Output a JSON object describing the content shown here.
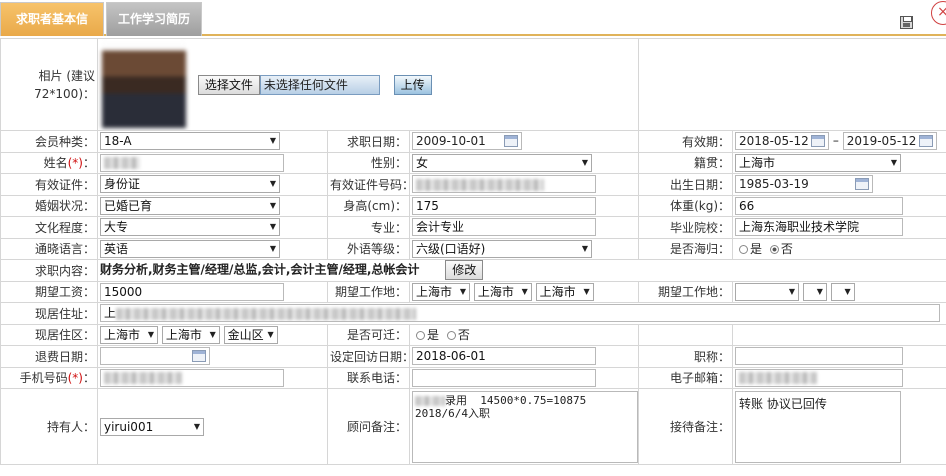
{
  "tabs": {
    "active": "求职者基本信息",
    "inactive": "工作学习简历"
  },
  "icons": {
    "save": "save-icon",
    "close": "close-icon"
  },
  "photo": {
    "label": "相片 (建议72*100)：",
    "choose_btn": "选择文件",
    "no_file": "未选择任何文件",
    "upload_btn": "上传"
  },
  "fields": {
    "member_type": {
      "label": "会员种类：",
      "value": "18-A"
    },
    "job_date": {
      "label": "求职日期：",
      "value": "2009-10-01"
    },
    "validity": {
      "label": "有效期：",
      "from": "2018-05-12",
      "sep": "–",
      "to": "2019-05-12"
    },
    "name": {
      "label": "姓名",
      "req": "(*)",
      "colon": "："
    },
    "gender": {
      "label": "性别：",
      "value": "女"
    },
    "native": {
      "label": "籍贯：",
      "value": "上海市"
    },
    "id_type": {
      "label": "有效证件：",
      "value": "身份证"
    },
    "id_no": {
      "label": "有效证件号码："
    },
    "birth": {
      "label": "出生日期：",
      "value": "1985-03-19"
    },
    "marital": {
      "label": "婚姻状况：",
      "value": "已婚已育"
    },
    "height": {
      "label": "身高(cm)：",
      "value": "175"
    },
    "weight": {
      "label": "体重(kg)：",
      "value": "66"
    },
    "education": {
      "label": "文化程度：",
      "value": "大专"
    },
    "major": {
      "label": "专业：",
      "value": "会计专业"
    },
    "school": {
      "label": "毕业院校：",
      "value": "上海东海职业技术学院"
    },
    "language": {
      "label": "通晓语言：",
      "value": "英语"
    },
    "lang_level": {
      "label": "外语等级：",
      "value": "六级(口语好)"
    },
    "overseas": {
      "label": "是否海归：",
      "yes": "是",
      "no": "否"
    },
    "job_content": {
      "label": "求职内容：",
      "value": "财务分析,财务主管/经理/总监,会计,会计主管/经理,总帐会计",
      "edit_btn": "修改"
    },
    "salary": {
      "label": "期望工资：",
      "value": "15000"
    },
    "work_place1": {
      "label": "期望工作地：",
      "v1": "上海市",
      "v2": "上海市",
      "v3": "上海市"
    },
    "work_place2": {
      "label": "期望工作地："
    },
    "address": {
      "label": "现居住址：",
      "prefix": "上"
    },
    "residence": {
      "label": "现居住区：",
      "v1": "上海市",
      "v2": "上海市",
      "v3": "金山区"
    },
    "relocate": {
      "label": "是否可迁：",
      "yes": "是",
      "no": "否"
    },
    "refund_date": {
      "label": "退费日期："
    },
    "visit_date": {
      "label": "设定回访日期：",
      "value": "2018-06-01"
    },
    "title": {
      "label": "职称："
    },
    "mobile": {
      "label": "手机号码",
      "req": "(*)",
      "colon": "："
    },
    "phone": {
      "label": "联系电话："
    },
    "email": {
      "label": "电子邮箱："
    },
    "holder": {
      "label": "持有人：",
      "value": "yirui001"
    },
    "consultant_note": {
      "label": "顾问备注：",
      "line1": "录用  14500*0.75=10875",
      "line2": "2018/6/4入职"
    },
    "reception_note": {
      "label": "接待备注：",
      "value": "转账 协议已回传"
    }
  }
}
